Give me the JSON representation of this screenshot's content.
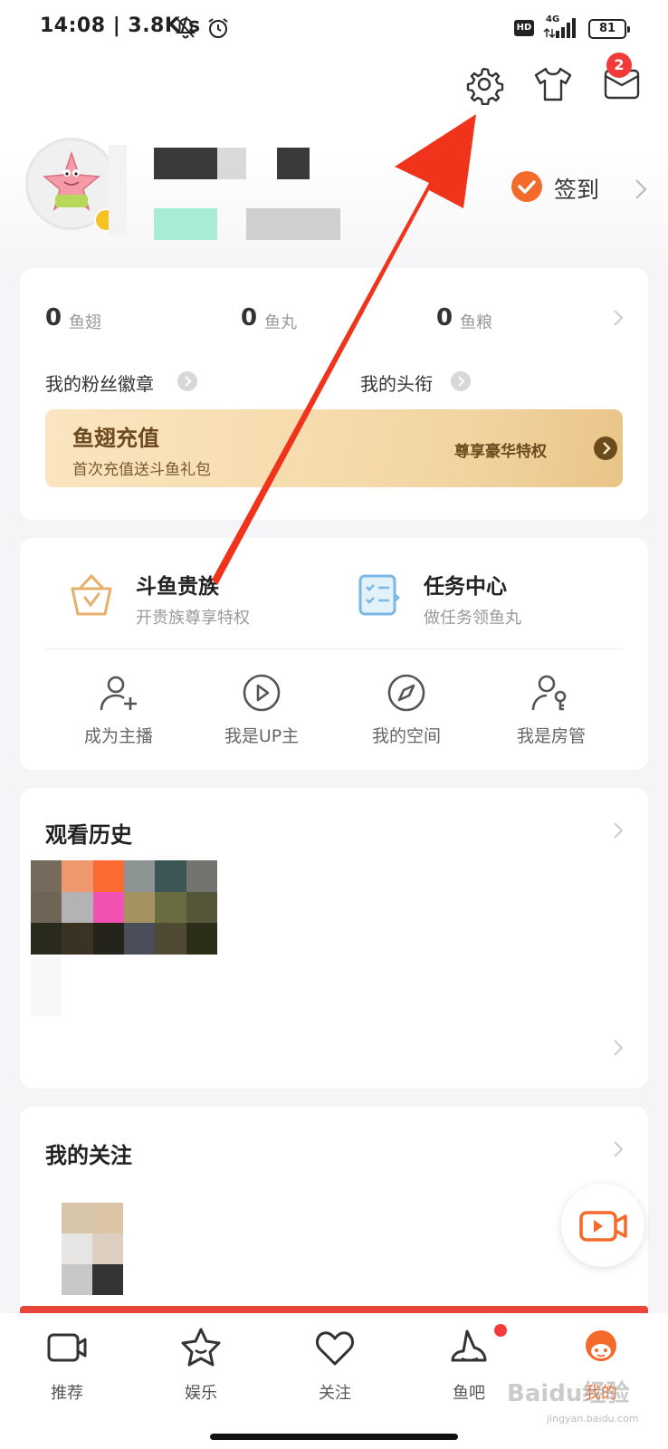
{
  "status_bar": {
    "time": "14:08 | 3.8K/s",
    "hd": "HD",
    "network": "4G",
    "battery": "81"
  },
  "header": {
    "icons": [
      "gear-icon",
      "shirt-icon",
      "mail-icon"
    ],
    "mail_badge": "2"
  },
  "profile": {
    "signin_label": "签到"
  },
  "wallet": {
    "stats": [
      {
        "value": "0",
        "label": "鱼翅"
      },
      {
        "value": "0",
        "label": "鱼丸"
      },
      {
        "value": "0",
        "label": "鱼粮"
      }
    ],
    "fan_badge_label": "我的粉丝徽章",
    "title_label": "我的头衔",
    "recharge": {
      "title": "鱼翅充值",
      "subtitle": "首次充值送斗鱼礼包",
      "cta": "尊享豪华特权"
    }
  },
  "features": {
    "nobility": {
      "title": "斗鱼贵族",
      "subtitle": "开贵族尊享特权"
    },
    "tasks": {
      "title": "任务中心",
      "subtitle": "做任务领鱼丸"
    },
    "grid": [
      {
        "label": "成为主播",
        "icon": "user-plus-icon"
      },
      {
        "label": "我是UP主",
        "icon": "play-circle-icon"
      },
      {
        "label": "我的空间",
        "icon": "compass-icon"
      },
      {
        "label": "我是房管",
        "icon": "user-key-icon"
      }
    ]
  },
  "history": {
    "title": "观看历史"
  },
  "following": {
    "title": "我的关注"
  },
  "tabbar": {
    "tabs": [
      {
        "label": "推荐",
        "icon": "tv-icon"
      },
      {
        "label": "娱乐",
        "icon": "star-face-icon"
      },
      {
        "label": "关注",
        "icon": "heart-icon"
      },
      {
        "label": "鱼吧",
        "icon": "fish-hat-icon"
      },
      {
        "label": "我的",
        "icon": "profile-mascot-icon"
      }
    ],
    "active_index": 4
  },
  "overlay": {
    "watermark": "Baidu经验",
    "watermark_sub": "jingyan.baidu.com"
  },
  "colors": {
    "accent": "#f36a2a",
    "badge_red": "#f23a3a",
    "gold_text": "#6b4a1e",
    "annotation_arrow": "#f0341c"
  }
}
